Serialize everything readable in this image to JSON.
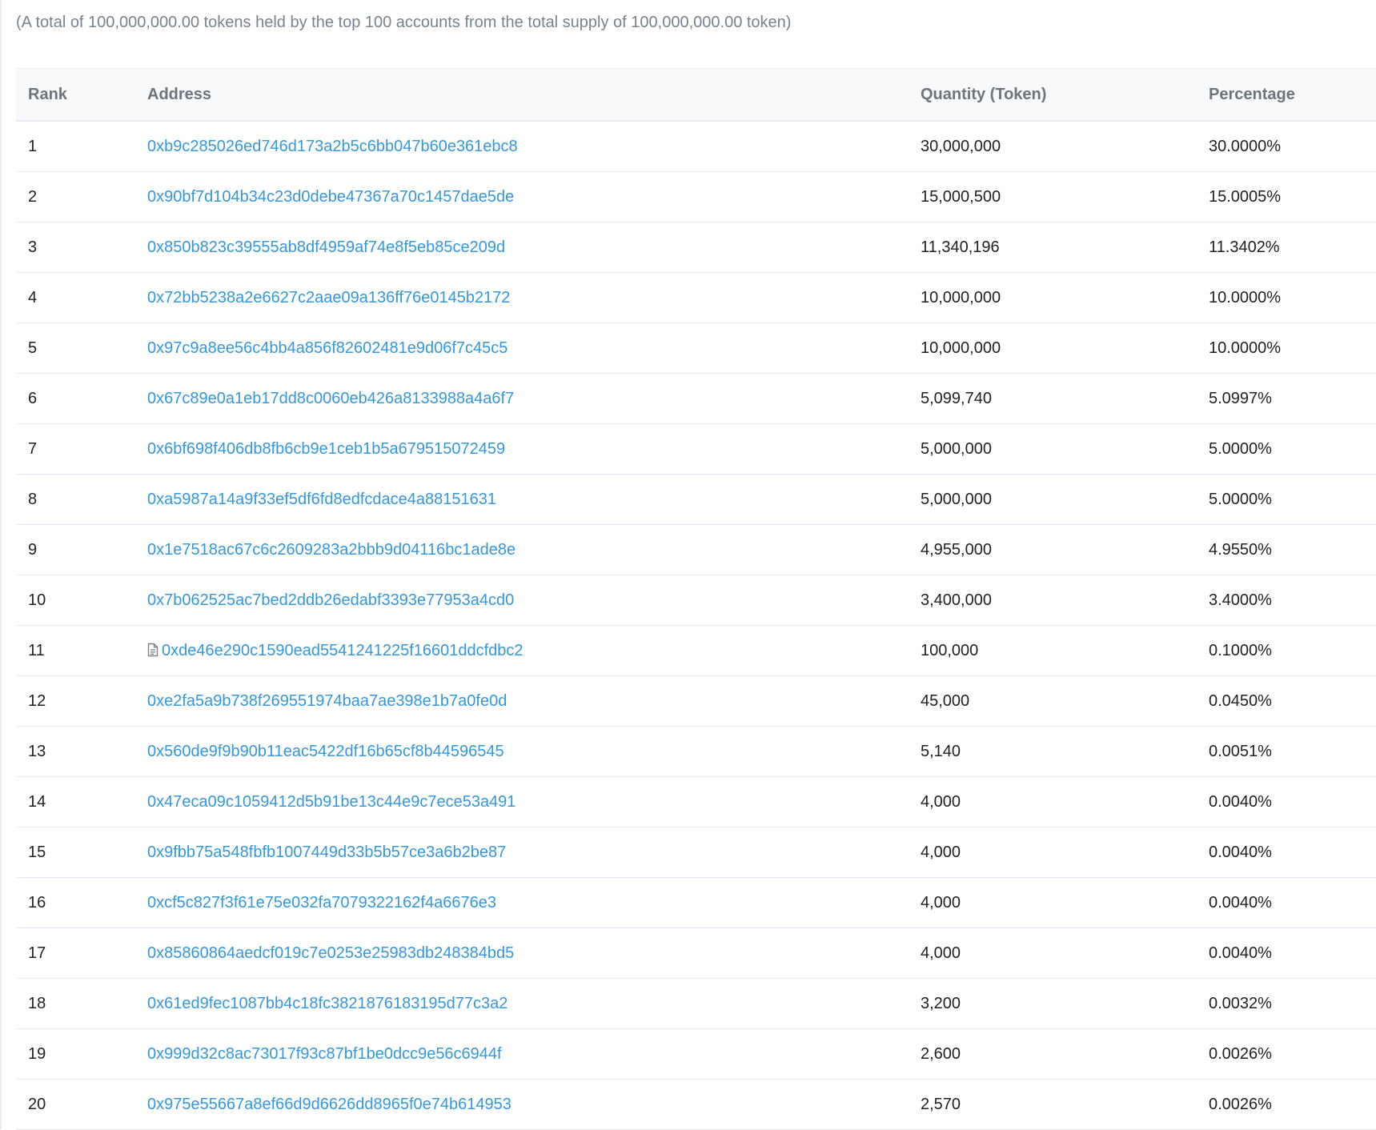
{
  "summary": {
    "text": "(A total of 100,000,000.00 tokens held by the top 100 accounts from the total supply of 100,000,000.00 token)"
  },
  "table": {
    "headers": {
      "rank": "Rank",
      "address": "Address",
      "quantity": "Quantity (Token)",
      "percentage": "Percentage"
    },
    "rows": [
      {
        "rank": "1",
        "address": "0xb9c285026ed746d173a2b5c6bb047b60e361ebc8",
        "quantity": "30,000,000",
        "percentage": "30.0000%",
        "contract": false
      },
      {
        "rank": "2",
        "address": "0x90bf7d104b34c23d0debe47367a70c1457dae5de",
        "quantity": "15,000,500",
        "percentage": "15.0005%",
        "contract": false
      },
      {
        "rank": "3",
        "address": "0x850b823c39555ab8df4959af74e8f5eb85ce209d",
        "quantity": "11,340,196",
        "percentage": "11.3402%",
        "contract": false
      },
      {
        "rank": "4",
        "address": "0x72bb5238a2e6627c2aae09a136ff76e0145b2172",
        "quantity": "10,000,000",
        "percentage": "10.0000%",
        "contract": false
      },
      {
        "rank": "5",
        "address": "0x97c9a8ee56c4bb4a856f82602481e9d06f7c45c5",
        "quantity": "10,000,000",
        "percentage": "10.0000%",
        "contract": false
      },
      {
        "rank": "6",
        "address": "0x67c89e0a1eb17dd8c0060eb426a8133988a4a6f7",
        "quantity": "5,099,740",
        "percentage": "5.0997%",
        "contract": false
      },
      {
        "rank": "7",
        "address": "0x6bf698f406db8fb6cb9e1ceb1b5a679515072459",
        "quantity": "5,000,000",
        "percentage": "5.0000%",
        "contract": false
      },
      {
        "rank": "8",
        "address": "0xa5987a14a9f33ef5df6fd8edfcdace4a88151631",
        "quantity": "5,000,000",
        "percentage": "5.0000%",
        "contract": false
      },
      {
        "rank": "9",
        "address": "0x1e7518ac67c6c2609283a2bbb9d04116bc1ade8e",
        "quantity": "4,955,000",
        "percentage": "4.9550%",
        "contract": false
      },
      {
        "rank": "10",
        "address": "0x7b062525ac7bed2ddb26edabf3393e77953a4cd0",
        "quantity": "3,400,000",
        "percentage": "3.4000%",
        "contract": false
      },
      {
        "rank": "11",
        "address": "0xde46e290c1590ead5541241225f16601ddcfdbc2",
        "quantity": "100,000",
        "percentage": "0.1000%",
        "contract": true
      },
      {
        "rank": "12",
        "address": "0xe2fa5a9b738f269551974baa7ae398e1b7a0fe0d",
        "quantity": "45,000",
        "percentage": "0.0450%",
        "contract": false
      },
      {
        "rank": "13",
        "address": "0x560de9f9b90b11eac5422df16b65cf8b44596545",
        "quantity": "5,140",
        "percentage": "0.0051%",
        "contract": false
      },
      {
        "rank": "14",
        "address": "0x47eca09c1059412d5b91be13c44e9c7ece53a491",
        "quantity": "4,000",
        "percentage": "0.0040%",
        "contract": false
      },
      {
        "rank": "15",
        "address": "0x9fbb75a548fbfb1007449d33b5b57ce3a6b2be87",
        "quantity": "4,000",
        "percentage": "0.0040%",
        "contract": false
      },
      {
        "rank": "16",
        "address": "0xcf5c827f3f61e75e032fa7079322162f4a6676e3",
        "quantity": "4,000",
        "percentage": "0.0040%",
        "contract": false
      },
      {
        "rank": "17",
        "address": "0x85860864aedcf019c7e0253e25983db248384bd5",
        "quantity": "4,000",
        "percentage": "0.0040%",
        "contract": false
      },
      {
        "rank": "18",
        "address": "0x61ed9fec1087bb4c18fc3821876183195d77c3a2",
        "quantity": "3,200",
        "percentage": "0.0032%",
        "contract": false
      },
      {
        "rank": "19",
        "address": "0x999d32c8ac73017f93c87bf1be0dcc9e56c6944f",
        "quantity": "2,600",
        "percentage": "0.0026%",
        "contract": false
      },
      {
        "rank": "20",
        "address": "0x975e55667a8ef66d9d6626dd8965f0e74b614953",
        "quantity": "2,570",
        "percentage": "0.0026%",
        "contract": false
      }
    ]
  },
  "icons": {
    "contract": "file-text-icon"
  },
  "colors": {
    "link": "#3498db",
    "muted_text": "#77838f",
    "header_bg": "#f8f9fa",
    "row_border": "#e7eaf3"
  }
}
